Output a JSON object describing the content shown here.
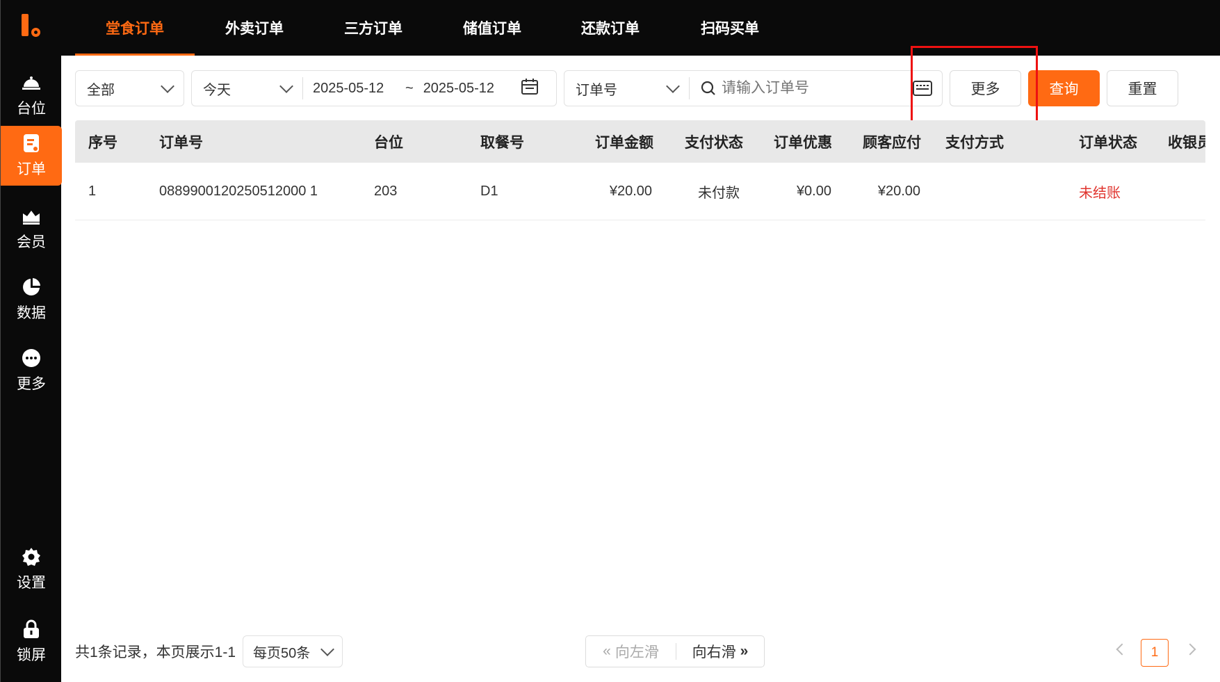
{
  "sidebar": {
    "items": [
      {
        "label": "台位",
        "icon": "bell-icon"
      },
      {
        "label": "订单",
        "icon": "order-icon"
      },
      {
        "label": "会员",
        "icon": "member-icon"
      },
      {
        "label": "数据",
        "icon": "pie-chart-icon"
      },
      {
        "label": "更多",
        "icon": "more-icon"
      },
      {
        "label": "设置",
        "icon": "gear-icon"
      },
      {
        "label": "锁屏",
        "icon": "lock-icon"
      }
    ],
    "active_index": 1
  },
  "tabs": [
    "堂食订单",
    "外卖订单",
    "三方订单",
    "储值订单",
    "还款订单",
    "扫码买单"
  ],
  "filters": {
    "scope": "全部",
    "period": "今天",
    "date_start": "2025-05-12",
    "date_sep": "~",
    "date_end": "2025-05-12",
    "search_field": "订单号",
    "search_placeholder": "请输入订单号"
  },
  "buttons": {
    "more": "更多",
    "query": "查询",
    "reset": "重置"
  },
  "table": {
    "headers": [
      "序号",
      "订单号",
      "台位",
      "取餐号",
      "订单金额",
      "支付状态",
      "订单优惠",
      "顾客应付",
      "支付方式",
      "订单状态",
      "收银员"
    ],
    "rows": [
      {
        "index": "1",
        "order_no": "0889900120250512000 1",
        "table": "203",
        "pickup": "D1",
        "amount": "¥20.00",
        "pay_status": "未付款",
        "discount": "¥0.00",
        "payable": "¥20.00",
        "pay_method": "",
        "order_status": "未结账",
        "cashier": ""
      }
    ]
  },
  "footer": {
    "summary": "共1条记录，本页展示1-1",
    "page_size": "每页50条",
    "scroll_left": "向左滑",
    "scroll_right": "向右滑",
    "current_page": "1"
  },
  "colors": {
    "accent": "#ff6a13",
    "dark": "#0a0a0a",
    "danger": "#e0342e"
  }
}
